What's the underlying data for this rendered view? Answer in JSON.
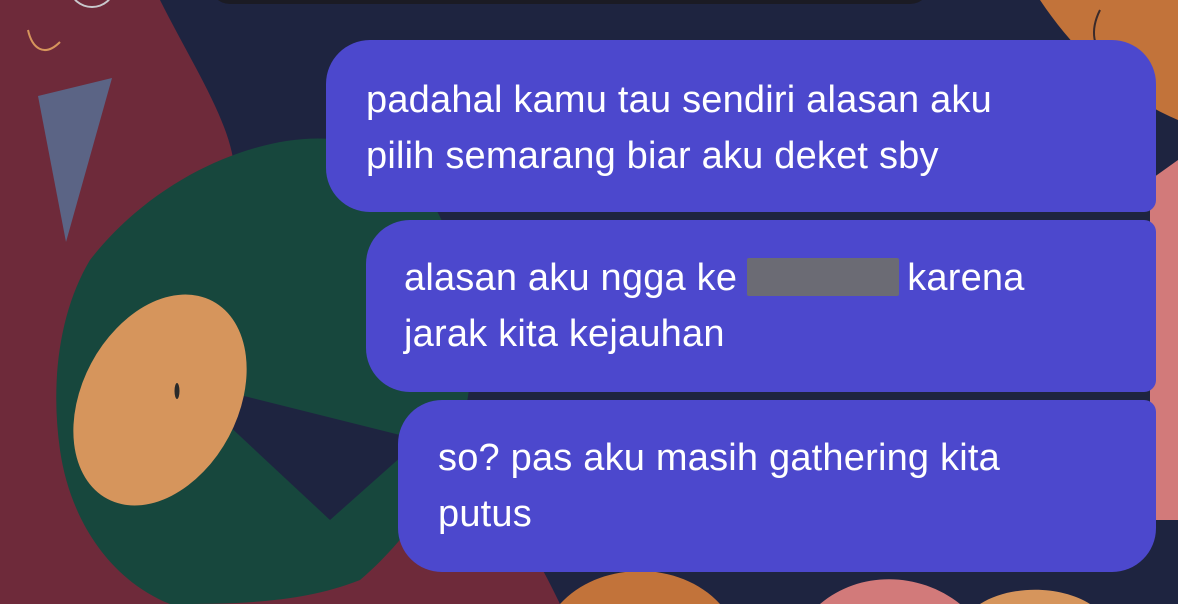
{
  "colors": {
    "bubble": "#4c48cd",
    "bubble_text": "#ffffff",
    "wallpaper_base": "#6e2a3a"
  },
  "messages": [
    {
      "lines": [
        "padahal kamu tau sendiri alasan aku",
        "pilih semarang biar aku deket sby"
      ]
    },
    {
      "line1_before": "alasan aku ngga ke",
      "line1_after": "karena",
      "line2": "jarak kita kejauhan",
      "redacted": true
    },
    {
      "lines": [
        "so? pas aku masih gathering kita",
        "putus"
      ]
    }
  ]
}
